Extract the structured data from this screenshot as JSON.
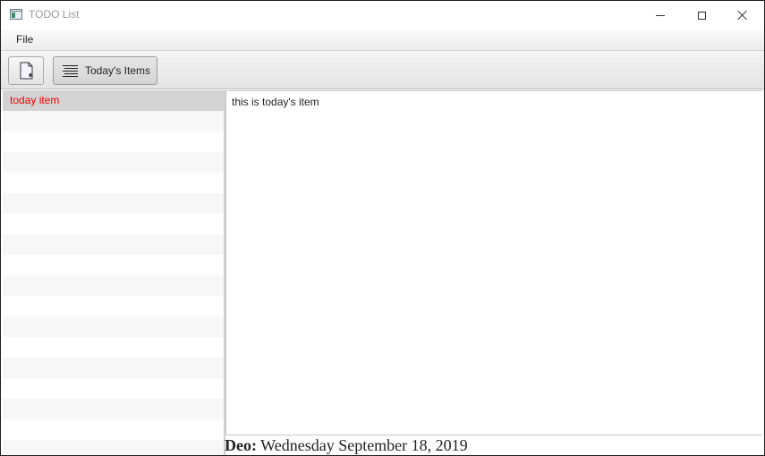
{
  "window": {
    "title": "TODO List",
    "controls": [
      "minimize",
      "maximize",
      "close"
    ]
  },
  "menubar": {
    "items": [
      {
        "label": "File"
      }
    ]
  },
  "toolbar": {
    "new_item_icon": "new-document-icon",
    "today_button": {
      "label": "Today's Items",
      "icon": "lines-icon"
    }
  },
  "list": {
    "items": [
      {
        "label": "today item",
        "selected": true,
        "color": "#ff0000"
      }
    ]
  },
  "detail": {
    "text": "this is today's item",
    "due_label": "Deo:",
    "due_date": "Wednesday September 18, 2019"
  }
}
